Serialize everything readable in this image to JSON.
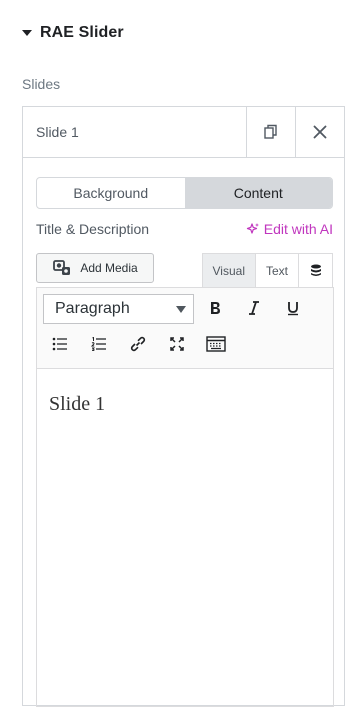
{
  "section": {
    "title": "RAE Slider"
  },
  "slides": {
    "label": "Slides",
    "item": {
      "title": "Slide 1",
      "tabs": [
        {
          "label": "Background"
        },
        {
          "label": "Content"
        }
      ],
      "field_label": "Title & Description",
      "ai_link": "Edit with AI",
      "editor": {
        "add_media": "Add Media",
        "modes": [
          {
            "label": "Visual"
          },
          {
            "label": "Text"
          }
        ],
        "format_value": "Paragraph",
        "content": "Slide 1"
      }
    }
  },
  "colors": {
    "accent_ai": "#c036be",
    "active_tab": "#d5d8dc"
  },
  "icons": [
    "caret-down-icon",
    "duplicate-icon",
    "close-icon",
    "sparkle-icon",
    "media-icon",
    "dynamic-tags-icon",
    "bold-icon",
    "italic-icon",
    "underline-icon",
    "bullet-list-icon",
    "numbered-list-icon",
    "link-icon",
    "fullscreen-icon",
    "keyboard-icon"
  ]
}
